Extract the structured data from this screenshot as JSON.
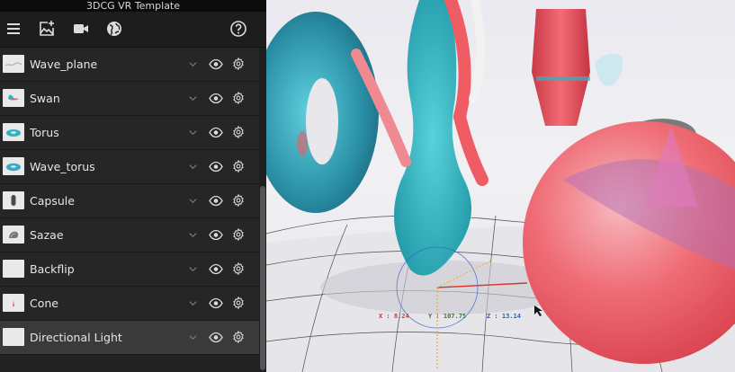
{
  "window": {
    "title": "3DCG VR Template"
  },
  "toolbar": {
    "menu_icon": "hamburger-menu-icon",
    "add_image_icon": "add-image-icon",
    "camera_icon": "video-camera-icon",
    "globe_icon": "globe-icon",
    "help_icon": "help-circle-icon"
  },
  "objects": [
    {
      "label": "Wave_plane"
    },
    {
      "label": "Swan"
    },
    {
      "label": "Torus"
    },
    {
      "label": "Wave_torus"
    },
    {
      "label": "Capsule"
    },
    {
      "label": "Sazae"
    },
    {
      "label": "Backflip"
    },
    {
      "label": "Cone"
    },
    {
      "label": "Directional Light"
    }
  ],
  "selected_object": "Directional Light",
  "row_icons": {
    "expand": "chevron-down-icon",
    "visibility": "eye-icon",
    "settings": "gear-icon"
  },
  "viewport": {
    "coordinates": {
      "x": "X : 8.24",
      "y": "Y : 107.75",
      "z": "Z : 13.14"
    }
  },
  "colors": {
    "panel_bg": "#232323",
    "selected_row": "#3a3a3a",
    "accent_teal": "#2fb3c4",
    "accent_coral": "#ef5c64",
    "axis_x": "#d8342b",
    "axis_y": "#3a7a2a",
    "axis_z": "#1f5fd0"
  }
}
